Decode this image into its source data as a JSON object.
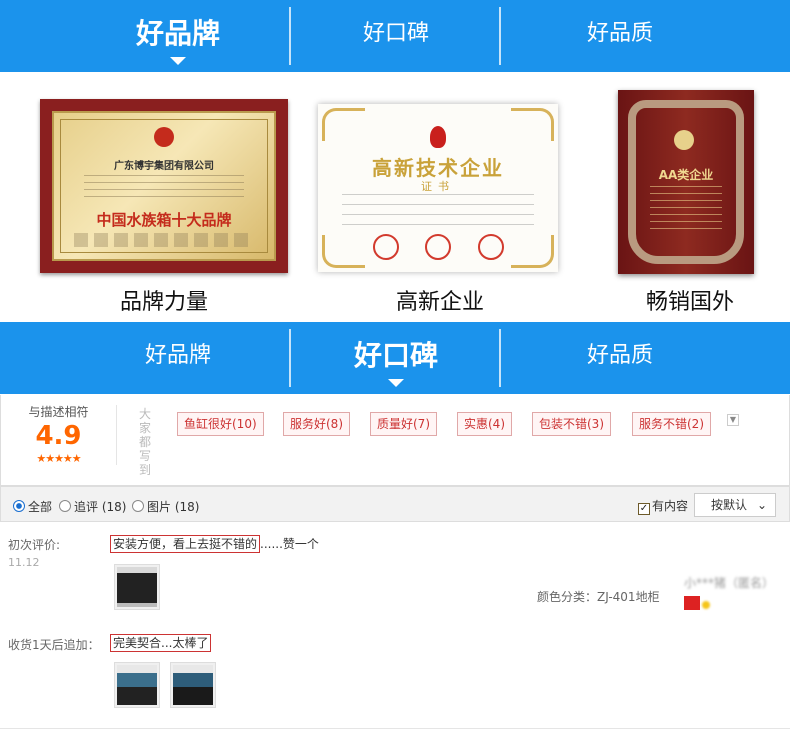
{
  "tabs_top": {
    "items": [
      "好品牌",
      "好口碑",
      "好品质"
    ],
    "active": 0
  },
  "certificates": [
    {
      "label": "品牌力量",
      "company": "广东博宇集团有限公司",
      "title": "中国水族箱十大品牌"
    },
    {
      "label": "高新企业",
      "title": "高新技术企业",
      "subtitle": "证书"
    },
    {
      "label": "畅销国外",
      "title": "AA类企业"
    }
  ],
  "tabs_bottom": {
    "items": [
      "好品牌",
      "好口碑",
      "好品质"
    ],
    "active": 1
  },
  "rating": {
    "label": "与描述相符",
    "score": "4.9",
    "stars": "★★★★★",
    "vertical_text": "大家都写到",
    "tags": [
      "鱼缸很好(10)",
      "服务好(8)",
      "质量好(7)",
      "实惠(4)",
      "包装不错(3)",
      "服务不错(2)"
    ]
  },
  "filter": {
    "all": "全部",
    "append": "追评 (18)",
    "pictures": "图片 (18)",
    "has_content": "有内容",
    "sort": "按默认"
  },
  "reviews": {
    "first_label": "初次评价:",
    "first_date": "11.12",
    "first_text_highlight": "安装方便，看上去挺不错的",
    "first_text_rest": "......赞一个",
    "color_info": "颜色分类：ZJ-401地柜",
    "user_name": "小***猪（匿名）",
    "append_label": "收货1天后追加：",
    "append_text": "完美契合...太棒了"
  },
  "colors": {
    "brand_blue": "#1b93ec",
    "score_orange": "#ff6600",
    "tag_red": "#cc3333"
  }
}
